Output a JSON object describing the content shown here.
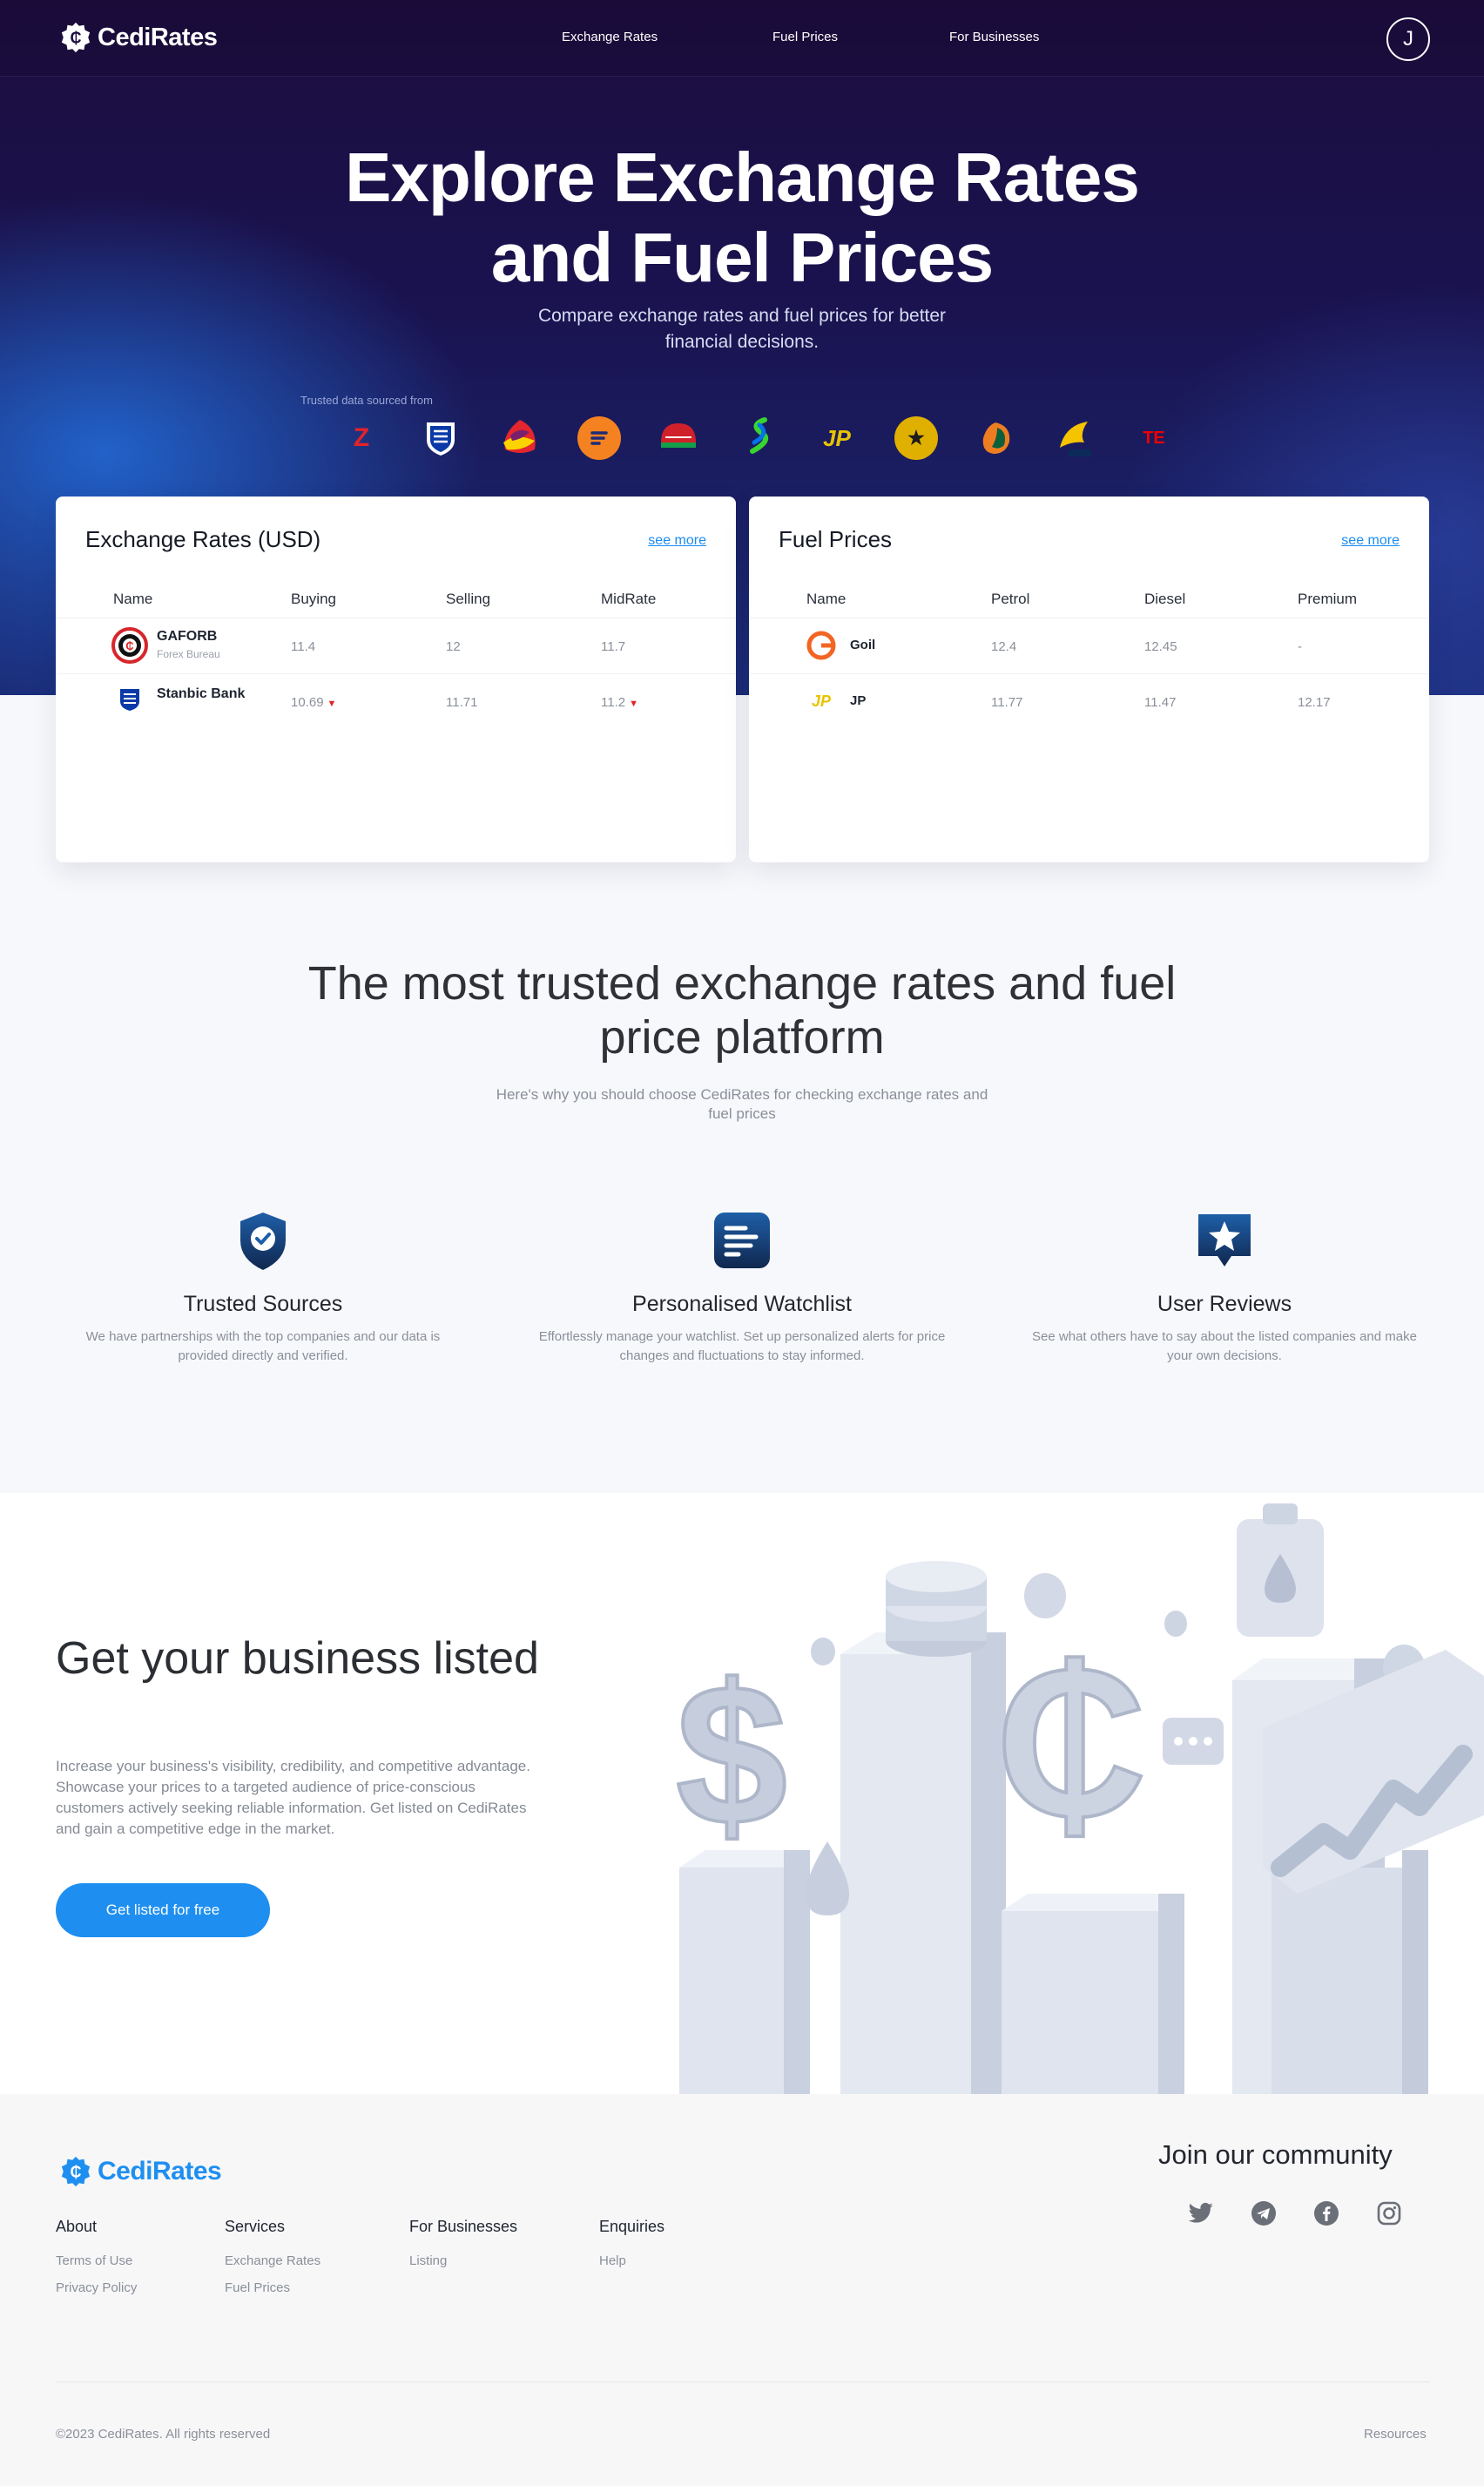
{
  "nav": {
    "brand": "CediRates",
    "links": [
      "Exchange Rates",
      "Fuel Prices",
      "For Businesses"
    ],
    "avatar_initial": "J"
  },
  "hero": {
    "title_line1": "Explore Exchange Rates",
    "title_line2": "and Fuel Prices",
    "subtitle_line1": "Compare exchange rates and fuel prices for better",
    "subtitle_line2": "financial decisions.",
    "trusted_label": "Trusted data sourced from",
    "partners": [
      {
        "icon": "zenith-logo",
        "label": "Z"
      },
      {
        "icon": "stanbic-logo",
        "label": ""
      },
      {
        "icon": "absa-logo",
        "label": ""
      },
      {
        "icon": "fidelity-logo",
        "label": ""
      },
      {
        "icon": "cal-bank-logo",
        "label": ""
      },
      {
        "icon": "standard-chartered-logo",
        "label": "S"
      },
      {
        "icon": "jp-logo",
        "label": "JP"
      },
      {
        "icon": "bank-of-ghana-logo",
        "label": "★"
      },
      {
        "icon": "access-bank-logo",
        "label": ""
      },
      {
        "icon": "ecobank-logo",
        "label": ""
      },
      {
        "icon": "total-energies-logo",
        "label": "TE"
      }
    ]
  },
  "exchange": {
    "title": "Exchange Rates (USD)",
    "see_more": "see more",
    "columns": [
      "Name",
      "Buying",
      "Selling",
      "MidRate"
    ],
    "rows": [
      {
        "name": "GAFORB",
        "sub": "Forex Bureau",
        "buying": "11.4",
        "selling": "12",
        "mid": "11.7"
      },
      {
        "name": "Stanbic Bank",
        "sub": "",
        "buying": "10.69",
        "selling": "11.71",
        "mid": "11.2"
      }
    ]
  },
  "fuel": {
    "title": "Fuel Prices",
    "see_more": "see more",
    "columns": [
      "Name",
      "Petrol",
      "Diesel",
      "Premium"
    ],
    "rows": [
      {
        "name": "Goil",
        "petrol": "12.4",
        "diesel": "12.45",
        "premium": "-"
      },
      {
        "name": "JP",
        "petrol": "11.77",
        "diesel": "11.47",
        "premium": "12.17"
      }
    ]
  },
  "why": {
    "title_line1": "The most trusted exchange rates and fuel",
    "title_line2": "price platform",
    "subtitle_line1": "Here's why you should choose CediRates for checking exchange rates and",
    "subtitle_line2": "fuel prices",
    "features": [
      {
        "title": "Trusted Sources",
        "text": "We have partnerships with the top companies and our data is provided directly and verified."
      },
      {
        "title": "Personalised Watchlist",
        "text": "Effortlessly manage your watchlist. Set up personalized alerts for price changes and fluctuations to stay informed."
      },
      {
        "title": "User Reviews",
        "text": "See what others have to say about the listed companies and make your own decisions."
      }
    ]
  },
  "business": {
    "title": "Get your business listed",
    "text": "Increase your business's visibility, credibility, and competitive advantage. Showcase your prices to a targeted audience of price-conscious customers actively seeking reliable information. Get listed on CediRates and gain a competitive edge in the market.",
    "button": "Get listed for free"
  },
  "footer": {
    "brand": "CediRates",
    "columns": [
      {
        "head": "About",
        "links": [
          "Terms of Use",
          "Privacy Policy"
        ]
      },
      {
        "head": "Services",
        "links": [
          "Exchange Rates",
          "Fuel Prices"
        ]
      },
      {
        "head": "For Businesses",
        "links": [
          "Listing"
        ]
      },
      {
        "head": "Enquiries",
        "links": [
          "Help"
        ]
      }
    ],
    "community": "Join our community",
    "socials": [
      "twitter-icon",
      "telegram-icon",
      "facebook-icon",
      "instagram-icon"
    ],
    "copyright": "©2023 CediRates. All rights reserved",
    "resources": "Resources"
  },
  "colors": {
    "accent": "#1e8ff0",
    "hero_dark": "#1c0d3e",
    "down": "#e02424"
  }
}
